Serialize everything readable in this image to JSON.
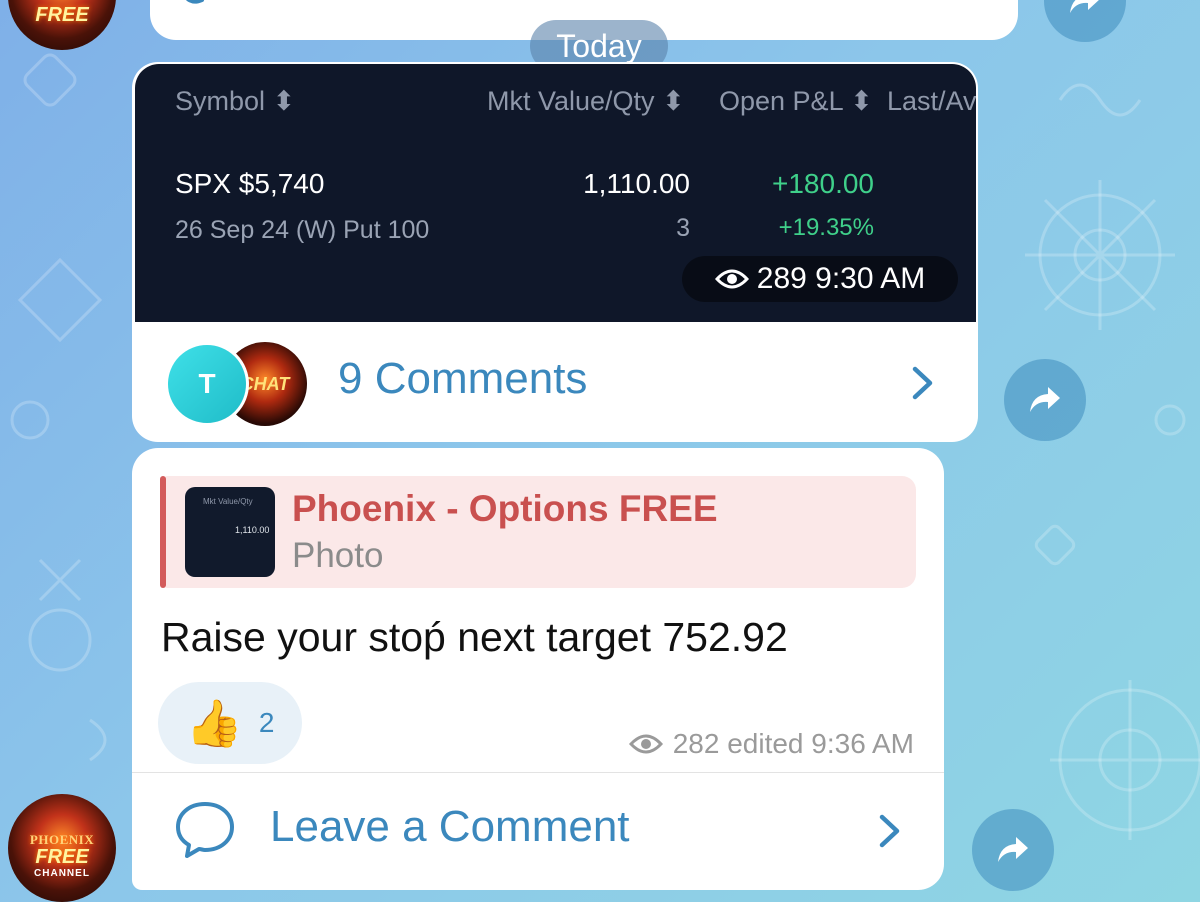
{
  "date_separator": "Today",
  "post1": {
    "screenshot": {
      "headers": [
        "Symbol ⬍",
        "Mkt Value/Qty ⬍",
        "Open P&L ⬍",
        "Last/Av"
      ],
      "symbol": "SPX $5,740",
      "contract": "26 Sep 24 (W) Put 100",
      "mkt_value": "1,110.00",
      "qty": "3",
      "pnl": "+180.00",
      "pnl_pct": "+19.35%"
    },
    "meta": "289 9:30 AM",
    "comments_label": "9 Comments",
    "avatar_letter": "T",
    "chat_avatar_text": "CHAT"
  },
  "post2": {
    "reply": {
      "title": "Phoenix - Options FREE",
      "subtitle": "Photo",
      "thumb_header": "Mkt Value/Qty",
      "thumb_value": "1,110.00"
    },
    "message": "Raise your stoṕ  next target 752.92",
    "reaction_count": "2",
    "reaction_emoji": "👍",
    "meta": "282 edited 9:36 AM",
    "comment_label": "Leave a Comment"
  },
  "channel_avatar": {
    "line1": "PHOENIX",
    "line2": "FREE",
    "line3": "CHANNEL"
  },
  "colors": {
    "accent": "#3b88bd",
    "reply_title": "#c9504f",
    "pnl_green": "#3fd08a",
    "screenshot_bg": "#0f1729"
  }
}
